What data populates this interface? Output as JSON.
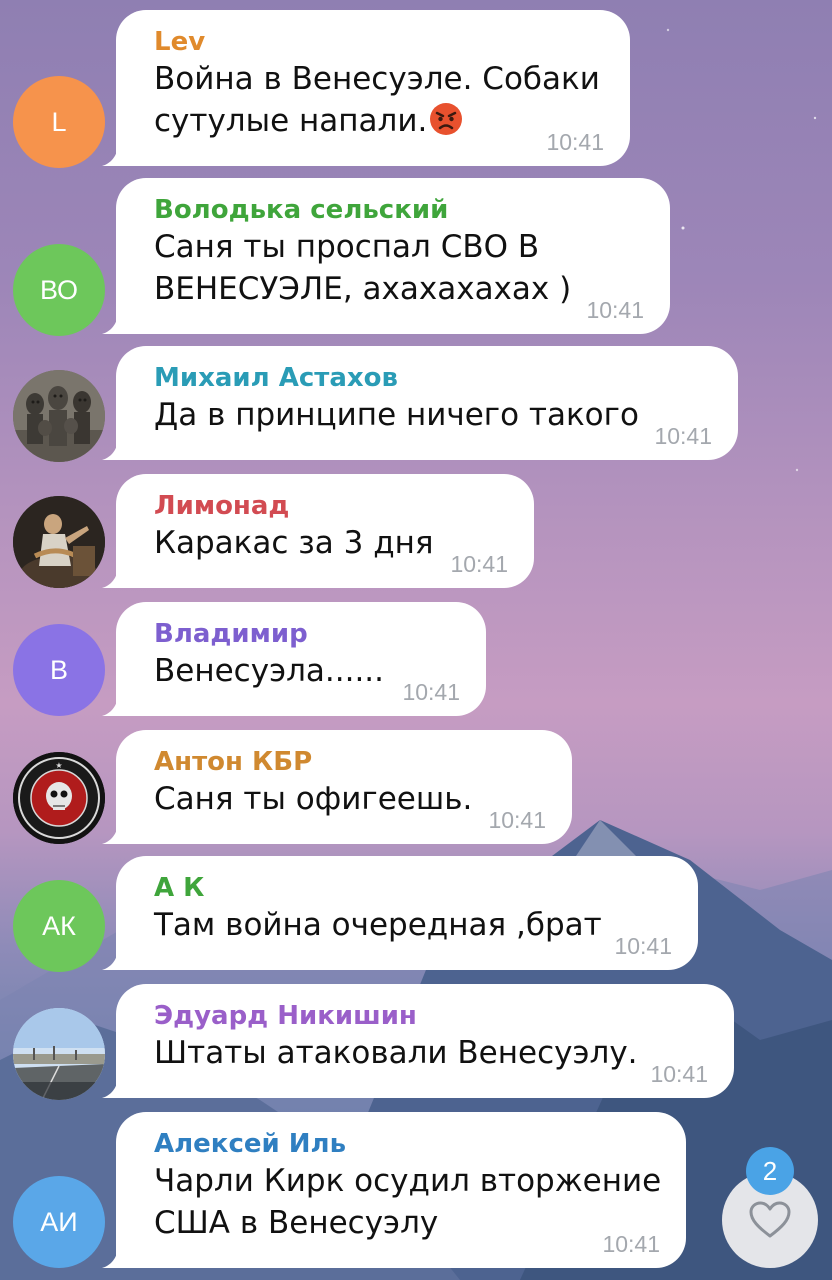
{
  "messages": [
    {
      "sender": "Lev",
      "sender_color": "#e08a2c",
      "avatar_type": "initials",
      "avatar_text": "L",
      "avatar_color": "#f6934c",
      "lines": [
        "Война в Венесуэле. Собаки",
        "сутулые напали."
      ],
      "emoji": "angry-face",
      "time": "10:41"
    },
    {
      "sender": "Володька сельский",
      "sender_color": "#3fa53b",
      "avatar_type": "initials",
      "avatar_text": "ВО",
      "avatar_color": "#6dc75b",
      "lines": [
        "Саня ты проспал СВО В",
        "ВЕНЕСУЭЛЕ, ахахахахах )"
      ],
      "time": "10:41"
    },
    {
      "sender": "Михаил Астахов",
      "sender_color": "#2a9cb6",
      "avatar_type": "photo",
      "avatar_icon": "statues-photo",
      "lines": [
        "Да в принципе ничего такого"
      ],
      "time": "10:41"
    },
    {
      "sender": "Лимонад",
      "sender_color": "#d24b52",
      "avatar_type": "photo",
      "avatar_icon": "performer-photo",
      "lines": [
        "Каракас за 3 дня"
      ],
      "time": "10:41"
    },
    {
      "sender": "Владимир",
      "sender_color": "#7d5fcf",
      "avatar_type": "initials",
      "avatar_text": "В",
      "avatar_color": "#8a73e5",
      "lines": [
        "Венесуэла......"
      ],
      "time": "10:41"
    },
    {
      "sender": "Антон КБР",
      "sender_color": "#d08930",
      "avatar_type": "logo",
      "avatar_icon": "wagner-logo",
      "lines": [
        "Саня ты офигеешь."
      ],
      "time": "10:41"
    },
    {
      "sender": "А К",
      "sender_color": "#3fa53b",
      "avatar_type": "initials",
      "avatar_text": "АК",
      "avatar_color": "#6dc75b",
      "lines": [
        "Там война очередная ,брат"
      ],
      "time": "10:41"
    },
    {
      "sender": "Эдуард Никишин",
      "sender_color": "#9a5fc9",
      "avatar_type": "photo",
      "avatar_icon": "road-photo",
      "lines": [
        "Штаты атаковали Венесуэлу."
      ],
      "time": "10:41"
    },
    {
      "sender": "Алексей Иль",
      "sender_color": "#2f7fc1",
      "avatar_type": "initials",
      "avatar_text": "АИ",
      "avatar_color": "#5aa7e8",
      "lines": [
        "Чарли Кирк осудил вторжение",
        "США в Венесуэлу"
      ],
      "time": "10:41"
    }
  ],
  "reaction_button": {
    "icon": "heart-icon",
    "count": "2",
    "badge_color": "#4aa3e6"
  }
}
